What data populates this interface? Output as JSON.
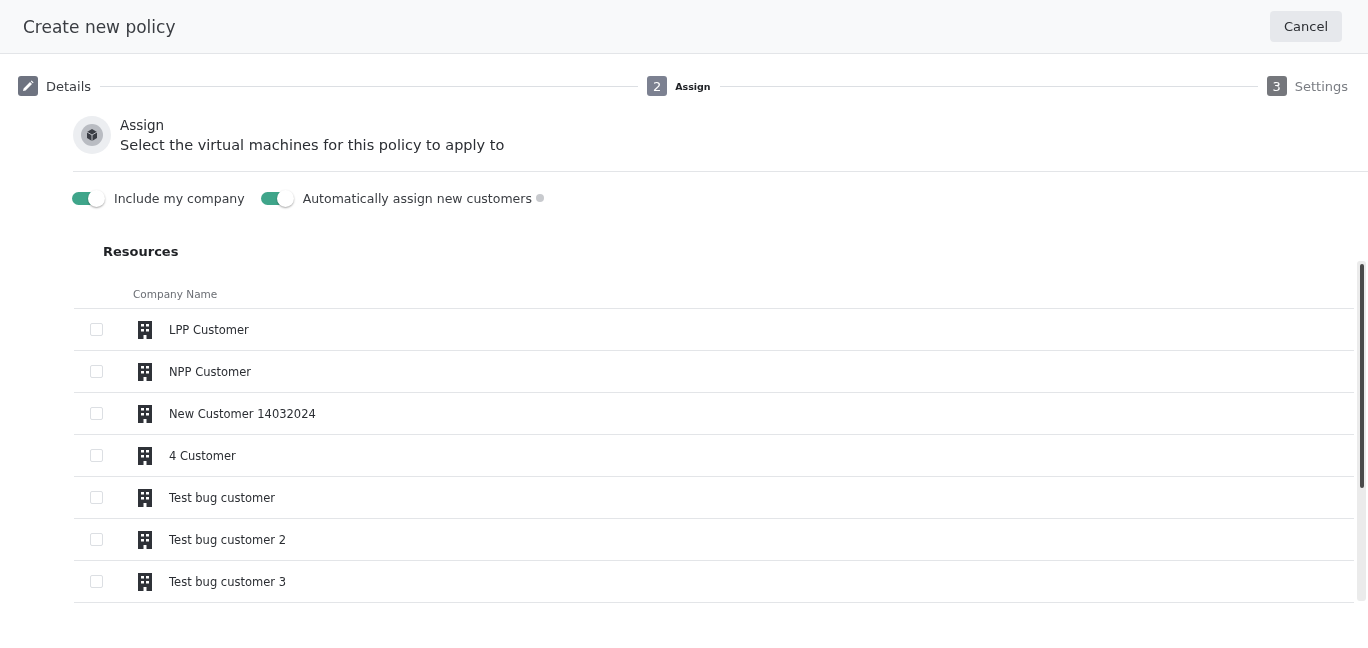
{
  "header": {
    "title": "Create new policy",
    "cancel_button": "Cancel"
  },
  "steps": [
    {
      "label": "Details",
      "kind": "done",
      "selected": false
    },
    {
      "marker": "2",
      "label": "Assign",
      "kind": "current",
      "selected": true
    },
    {
      "marker": "3",
      "label": "Settings",
      "kind": "upcoming",
      "selected": false
    }
  ],
  "section": {
    "title": "Assign",
    "subtitle": "Select the virtual machines for this policy to apply to"
  },
  "toggles": [
    {
      "label": "Include my company",
      "on": true,
      "info": false
    },
    {
      "label": "Automatically assign new customers",
      "on": true,
      "info": true
    }
  ],
  "resources": {
    "title": "Resources",
    "columns": [
      "Company Name"
    ],
    "rows": [
      {
        "name": "LPP Customer",
        "checked": false
      },
      {
        "name": "NPP Customer",
        "checked": false
      },
      {
        "name": "New Customer 14032024",
        "checked": false
      },
      {
        "name": "4 Customer",
        "checked": false
      },
      {
        "name": "Test bug customer",
        "checked": false
      },
      {
        "name": "Test bug customer 2",
        "checked": false
      },
      {
        "name": "Test bug customer 3",
        "checked": false
      }
    ]
  }
}
